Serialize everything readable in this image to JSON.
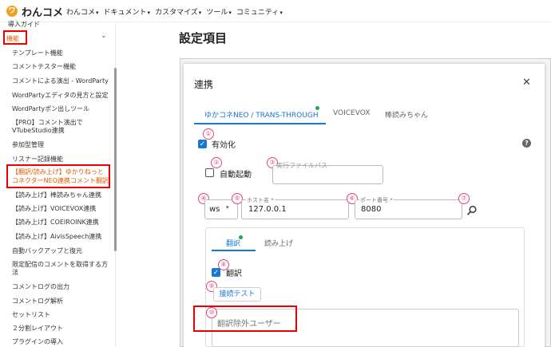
{
  "app": {
    "logo_glyph": "ワ",
    "title": "わんコメ"
  },
  "nav": [
    {
      "label": "わんコメ"
    },
    {
      "label": "ドキュメント"
    },
    {
      "label": "カスタマイズ"
    },
    {
      "label": "ツール"
    },
    {
      "label": "コミュニティ"
    }
  ],
  "sidebar": {
    "items": [
      {
        "label": "導入ガイド"
      },
      {
        "label": "機能"
      },
      {
        "label": "テンプレート機能"
      },
      {
        "label": "コメントテスター機能"
      },
      {
        "label": "コメントによる演出 - WordParty"
      },
      {
        "label": "WordPartyエディタの見方と設定"
      },
      {
        "label": "WordPartyポン出しツール"
      },
      {
        "label": "【PRO】コメント演出で"
      },
      {
        "label": "VTubeStudio連携"
      },
      {
        "label": "参加型管理"
      },
      {
        "label": "リスナー記録機能"
      },
      {
        "label": "【翻訳/読み上げ】ゆかりねっと"
      },
      {
        "label": "コネクターNEO連携コメント翻訳"
      },
      {
        "label": "【読み上げ】棒読みちゃん連携"
      },
      {
        "label": "【読み上げ】VOICEVOX連携"
      },
      {
        "label": "【読み上げ】COEIROINK連携"
      },
      {
        "label": "【読み上げ】AivisSpeech連携"
      },
      {
        "label": "自動バックアップと復元"
      },
      {
        "label": "限定配信のコメントを取得する方"
      },
      {
        "label": "法"
      },
      {
        "label": "コメントログの出力"
      },
      {
        "label": "コメントログ解析"
      },
      {
        "label": "セットリスト"
      },
      {
        "label": "２分割レイアウト"
      },
      {
        "label": "プラグインの導入"
      }
    ]
  },
  "page": {
    "title": "設定項目"
  },
  "dialog": {
    "title": "連携",
    "tabs": [
      {
        "label": "ゆかコネNEO / TRANS-THROUGH"
      },
      {
        "label": "VOICEVOX"
      },
      {
        "label": "棒読みちゃん"
      }
    ],
    "enabled_label": "有効化",
    "autostart_label": "自動起動",
    "exe_path_placeholder": "実行ファイルパス",
    "protocol_value": "ws",
    "host_label": "ホスト名 *",
    "host_value": "127.0.0.1",
    "port_label": "ポート番号 *",
    "port_value": "8080",
    "subtabs": [
      {
        "label": "翻訳"
      },
      {
        "label": "読み上げ"
      }
    ],
    "translate_label": "翻訳",
    "test_button": "接続テスト",
    "exclude_users_placeholder": "翻訳除外ユーザー"
  },
  "markers": [
    "①",
    "②",
    "③",
    "④",
    "⑤",
    "⑥",
    "⑦",
    "⑧",
    "⑨",
    "⑩"
  ],
  "colors": {
    "accent": "#1976d2",
    "marker": "#e0457b",
    "highlight": "#e00000",
    "status_dot": "#2e9e5b"
  }
}
